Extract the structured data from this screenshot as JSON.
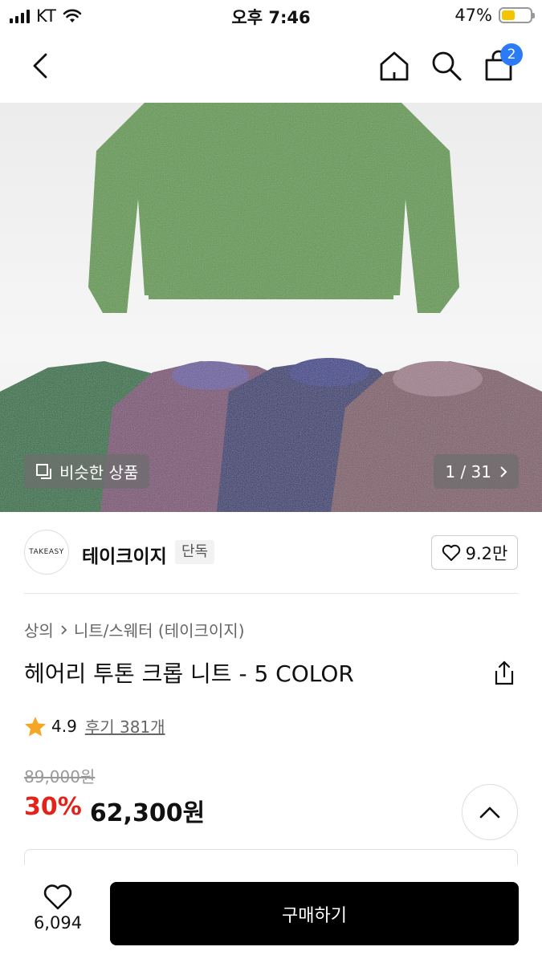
{
  "status_bar": {
    "carrier": "KT",
    "time": "오후 7:46",
    "battery": "47%",
    "battery_level": 0.47
  },
  "nav": {
    "icons": [
      "back-icon",
      "home-icon",
      "search-icon",
      "cart-icon"
    ],
    "cart_count": "2"
  },
  "hero": {
    "similar_label": "비슷한 상품",
    "page_counter": "1 / 31",
    "sweater_colors": [
      "#5f9a4a",
      "#1f6e3e",
      "#7a4d73",
      "#2c2f6e",
      "#7f5a66"
    ]
  },
  "brand": {
    "logo_text": "TAKEASY",
    "name": "테이크이지",
    "tag": "단독",
    "likes": "9.2만"
  },
  "breadcrumb": {
    "level1": "상의",
    "level2": "니트/스웨터 (테이크이지)"
  },
  "product": {
    "title": "헤어리 투톤 크롭 니트 - 5 COLOR",
    "rating": "4.9",
    "reviews": "후기 381개",
    "original_price": "89,000원",
    "discount": "30%",
    "price": "62,300원"
  },
  "bottom": {
    "wish_count": "6,094",
    "buy_label": "구매하기"
  }
}
